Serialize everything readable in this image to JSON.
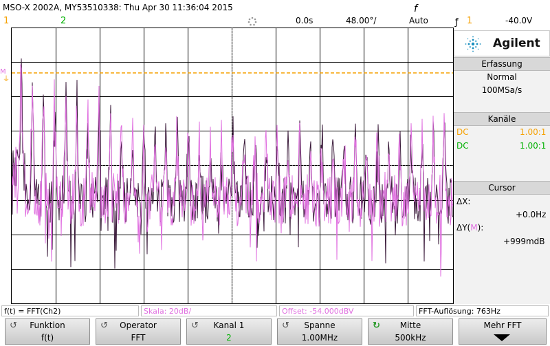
{
  "header": {
    "title": "MSO-X 2002A, MY53510338: Thu Apr 30 11:36:04 2015",
    "channel1_label": "1",
    "channel2_label": "2",
    "time_offset": "0.0s",
    "timebase": "48.00°/",
    "mode": "Auto",
    "trigger_icon": "f",
    "trigger_channel": "1",
    "trigger_level": "-40.0V"
  },
  "brand": {
    "name": "Agilent",
    "logo": "agilent-spark-logo"
  },
  "acquisition": {
    "header": "Erfassung",
    "mode": "Normal",
    "rate": "100MSa/s"
  },
  "channels": {
    "header": "Kanäle",
    "rows": [
      {
        "coupling": "DC",
        "scale": "1.00:1",
        "color": "#f5a000"
      },
      {
        "coupling": "DC",
        "scale": "1.00:1",
        "color": "#00b000"
      }
    ]
  },
  "cursor": {
    "header": "Cursor",
    "dx_label": "ΔX:",
    "dx_value": "+0.0Hz",
    "dy_label_prefix": "ΔY(",
    "dy_label_m": "M",
    "dy_label_suffix": "):",
    "dy_value": "+999mdB"
  },
  "info_bar": {
    "function": "f(t) = FFT(Ch2)",
    "scale": "Skala: 20dB/",
    "offset": "Offset: -54.000dBV",
    "resolution": "FFT-Auflösung: 763Hz"
  },
  "softkeys": [
    {
      "name": "Funktion",
      "value": "f(t)"
    },
    {
      "name": "Operator",
      "value": "FFT"
    },
    {
      "name": "Kanal 1",
      "value": "2"
    },
    {
      "name": "Spanne",
      "value": "1.00MHz"
    },
    {
      "name": "Mitte",
      "value": "500kHz"
    },
    {
      "name": "Mehr FFT",
      "value": ""
    }
  ],
  "colors": {
    "ch1": "#f5a000",
    "ch2": "#00b000",
    "math": "#e070e0",
    "trace_dark": "#3a1a3a",
    "grid": "#000000",
    "accent": "#1a8fbf"
  }
}
